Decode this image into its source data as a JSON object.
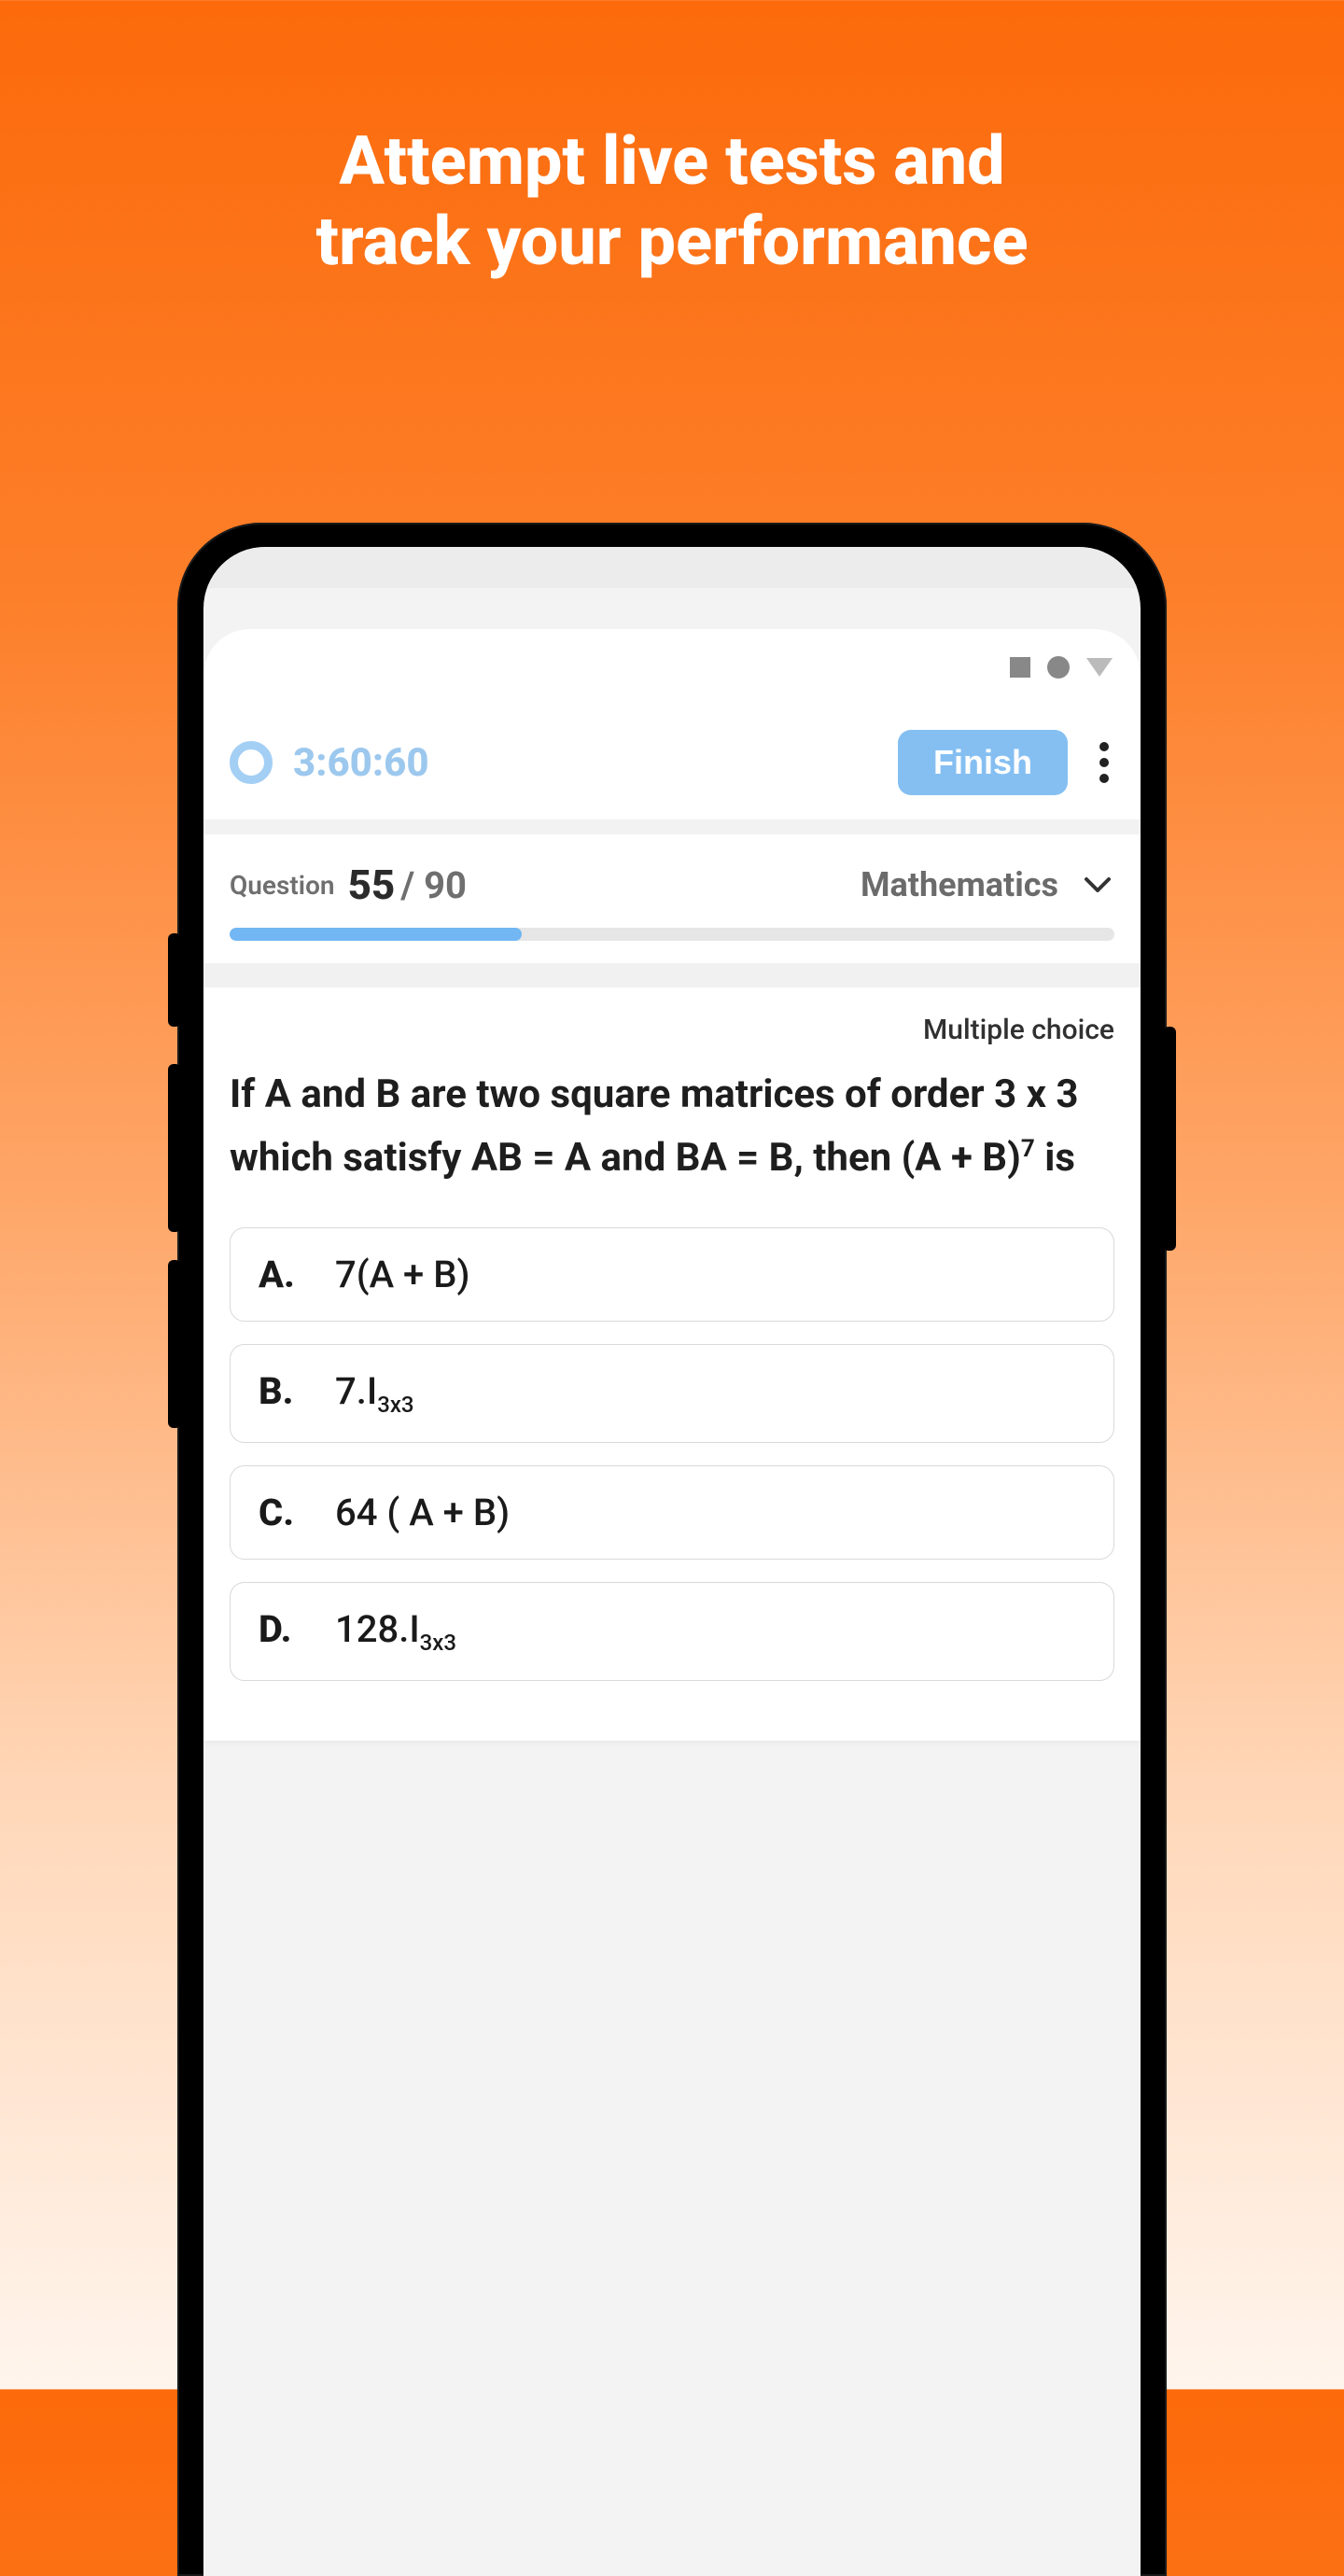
{
  "marketing": {
    "line1": "Attempt live tests and",
    "line2": "track your performance"
  },
  "timer": {
    "value": "3:60:60"
  },
  "finish_label": "Finish",
  "question_header": {
    "label": "Question",
    "current": "55",
    "total": "/ 90",
    "subject": "Mathematics",
    "progress_percent": 33
  },
  "question": {
    "type_label": "Multiple choice",
    "text_html": "If A and B are two square matrices of order 3 x 3 which satisfy AB = A and BA = B, then (A + B)<sup>7</sup> is"
  },
  "options": [
    {
      "letter": "A.",
      "html": "7(A + B)"
    },
    {
      "letter": "B.",
      "html": "7.I<sub>3x3</sub>"
    },
    {
      "letter": "C.",
      "html": "64 ( A + B)"
    },
    {
      "letter": "D.",
      "html": "128.I<sub>3x3</sub>"
    }
  ]
}
